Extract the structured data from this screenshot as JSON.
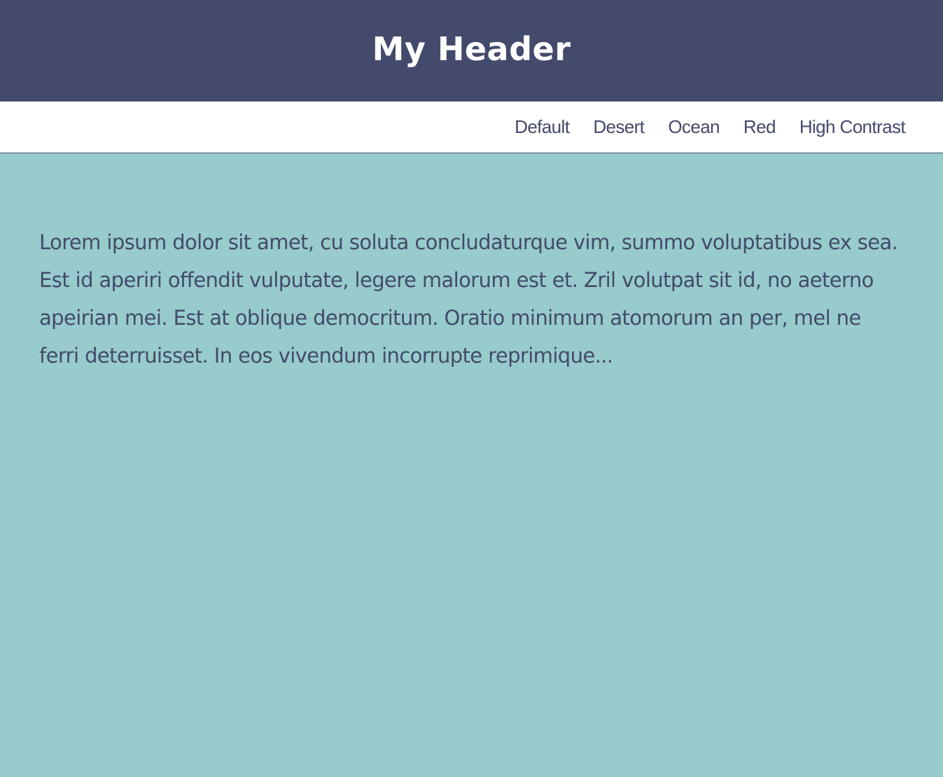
{
  "header": {
    "title": "My Header"
  },
  "nav": {
    "items": [
      {
        "label": "Default"
      },
      {
        "label": "Desert"
      },
      {
        "label": "Ocean"
      },
      {
        "label": "Red"
      },
      {
        "label": "High Contrast"
      }
    ]
  },
  "main": {
    "paragraph": "Lorem ipsum dolor sit amet, cu soluta concludaturque vim, summo voluptatibus ex sea. Est id aperiri offendit vulputate, legere malorum est et. Zril volutpat sit id, no aeterno apeirian mei. Est at oblique democritum. Oratio minimum atomorum an per, mel ne ferri deterruisset. In eos vivendum incorrupte reprimique..."
  },
  "colors": {
    "header_bg": "#434a6b",
    "header_text": "#ffffff",
    "nav_bg": "#ffffff",
    "accent_text": "#434a6b",
    "page_bg": "#98cbcb"
  }
}
